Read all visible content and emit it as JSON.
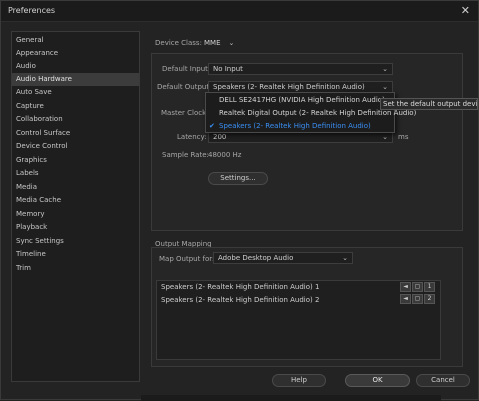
{
  "window": {
    "title": "Preferences",
    "close_glyph": "✕"
  },
  "sidebar": {
    "items": [
      {
        "label": "General"
      },
      {
        "label": "Appearance"
      },
      {
        "label": "Audio"
      },
      {
        "label": "Audio Hardware",
        "selected": true
      },
      {
        "label": "Auto Save"
      },
      {
        "label": "Capture"
      },
      {
        "label": "Collaboration"
      },
      {
        "label": "Control Surface"
      },
      {
        "label": "Device Control"
      },
      {
        "label": "Graphics"
      },
      {
        "label": "Labels"
      },
      {
        "label": "Media"
      },
      {
        "label": "Media Cache"
      },
      {
        "label": "Memory"
      },
      {
        "label": "Playback"
      },
      {
        "label": "Sync Settings"
      },
      {
        "label": "Timeline"
      },
      {
        "label": "Trim"
      }
    ]
  },
  "hardware": {
    "device_class_label": "Device Class:",
    "device_class_value": "MME",
    "default_input_label": "Default Input:",
    "default_input_value": "No Input",
    "default_output_label": "Default Output:",
    "default_output_value": "Speakers (2- Realtek High Definition Audio)",
    "master_clock_label": "Master Clock:",
    "latency_label": "Latency:",
    "latency_value": "200",
    "latency_unit": "ms",
    "sample_rate_label": "Sample Rate:",
    "sample_rate_value": "48000 Hz",
    "settings_button": "Settings..."
  },
  "output_popup": {
    "items": [
      {
        "label": "DELL SE2417HG (NVIDIA High Definition Audio)",
        "selected": false
      },
      {
        "label": "Realtek Digital Output (2- Realtek High Definition Audio)",
        "selected": false
      },
      {
        "label": "Speakers (2- Realtek High Definition Audio)",
        "selected": true
      }
    ],
    "check_glyph": "✔",
    "tooltip": "Set the default output device"
  },
  "output_mapping": {
    "section_label": "Output Mapping",
    "map_output_for_label": "Map Output for:",
    "map_output_for_value": "Adobe Desktop Audio",
    "rows": [
      {
        "label": "Speakers (2- Realtek High Definition Audio) 1",
        "channel": "1"
      },
      {
        "label": "Speakers (2- Realtek High Definition Audio) 2",
        "channel": "2"
      }
    ]
  },
  "footer": {
    "help_button": "Help",
    "ok_button": "OK",
    "cancel_button": "Cancel"
  },
  "colors": {
    "accent": "#3a8ff5",
    "background": "#232323"
  },
  "icons": {
    "chevron": "⌄"
  }
}
